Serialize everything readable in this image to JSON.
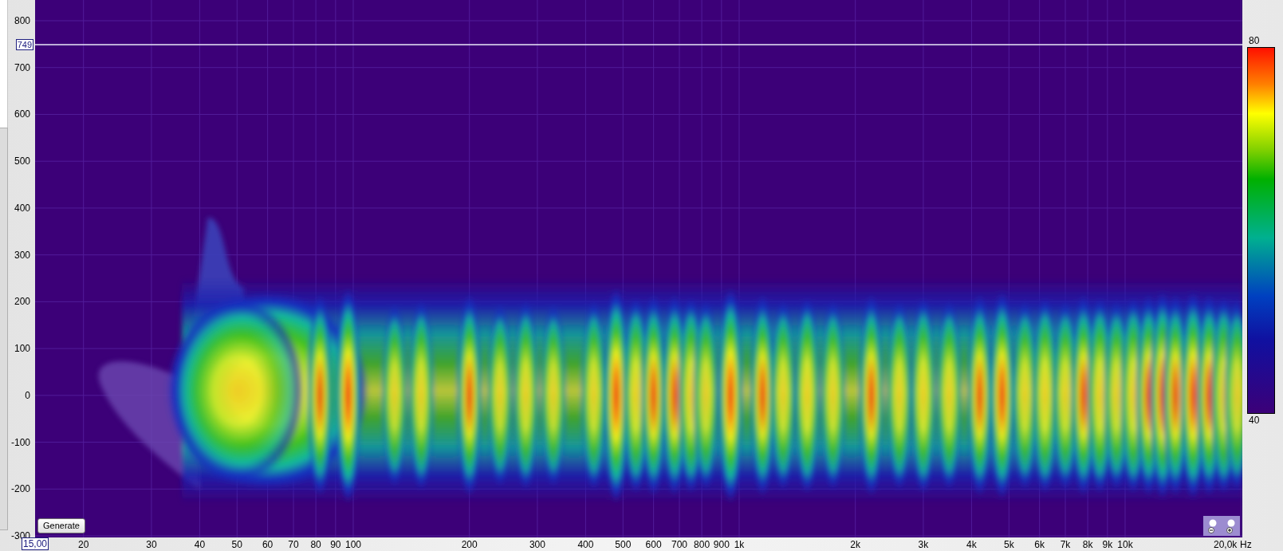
{
  "y_axis": {
    "ticks": [
      "800",
      "700",
      "600",
      "500",
      "400",
      "300",
      "200",
      "100",
      "0",
      "-100",
      "-200",
      "-300"
    ],
    "cursor_value": "749"
  },
  "x_axis": {
    "start_value": "15,00",
    "ticks": [
      "20",
      "30",
      "40",
      "50",
      "60",
      "70",
      "80",
      "90",
      "100",
      "200",
      "300",
      "400",
      "500",
      "600",
      "700",
      "800",
      "900",
      "1k",
      "2k",
      "3k",
      "4k",
      "5k",
      "6k",
      "7k",
      "8k",
      "9k",
      "10k",
      "20,0k"
    ],
    "unit": "Hz"
  },
  "color_scale": {
    "max": "80",
    "min": "40"
  },
  "generate_button": {
    "label": "Generate"
  }
}
